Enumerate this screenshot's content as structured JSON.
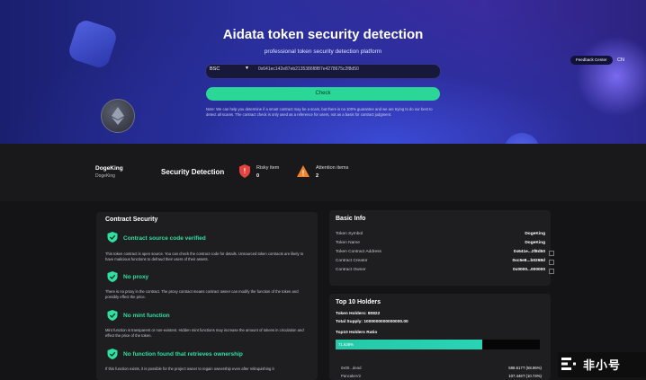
{
  "hero": {
    "title": "Aidata token security detection",
    "subtitle": "professional token security detection platform",
    "chain": "BSC",
    "address_value": "0x641ec142e87eb2135386f8f87e4278675c2f8d50",
    "check_label": "Check",
    "note": "Note: We can help you determine if a smart contract may be a scam, but there is no 100% guarantee and we are trying to do our best to detect all scams. The contract check is only used as a reference for users, not as a basis for contract judgment.",
    "feedback_label": "Feedback Center",
    "lang_label": "CN"
  },
  "token": {
    "name": "DogeKing",
    "symbol": "DogeKing",
    "section_title": "Security Detection",
    "risky_label": "Risky item",
    "risky_count": "0",
    "attention_label": "Attention items",
    "attention_count": "2",
    "colors": {
      "risky": "#e8423f",
      "attention": "#f0822a"
    }
  },
  "contract_security": {
    "title": "Contract Security",
    "items": [
      {
        "icon": "shield-check-icon",
        "title": "Contract source code verified",
        "desc": "This token contract is open source. You can check the contract code for details. Unsourced token contracts are likely to have malicious functions to defraud their users of their assets."
      },
      {
        "icon": "shield-check-icon",
        "title": "No proxy",
        "desc": "There is no proxy in the contract. The proxy contract means contract owner can modify the function of the token and possibly effect the price."
      },
      {
        "icon": "shield-check-icon",
        "title": "No mint function",
        "desc": "Mint function is transparent or non-existent. Hidden mint functions may increase the amount of tokens in circulation and effect the price of the token."
      },
      {
        "icon": "shield-check-icon",
        "title": "No function found that retrieves ownership",
        "desc": "If this function exists, it is possible for the project owner to regain ownership even after relinquishing it"
      }
    ],
    "accent": "#2fe0a0"
  },
  "basic_info": {
    "title": "Basic Info",
    "rows": [
      {
        "label": "Token Symbol",
        "value": "DogeKing"
      },
      {
        "label": "Token Name",
        "value": "DogeKing"
      },
      {
        "label": "Token Contract Address",
        "value": "0x641e...2f8d50"
      },
      {
        "label": "Contract Creator",
        "value": "0xc5e8...b0268d"
      },
      {
        "label": "Contract Owner",
        "value": "0x0000...000000"
      }
    ]
  },
  "top_holders": {
    "title": "Top 10 Holders",
    "holders_line": "Token Holders: 80822",
    "supply_line": "Total Supply: 1000000000000000.00",
    "ratio_label": "Top10 Holders Ratio",
    "ratio_text": "71.638%",
    "ratio_fraction": 0.71638,
    "rows": [
      {
        "label": "0x00...dead",
        "value": "588.617T (58.86%)"
      },
      {
        "label": "PancakeV2",
        "value": "107.446T (10.74%)"
      }
    ]
  },
  "watermark": {
    "text": "非小号"
  }
}
